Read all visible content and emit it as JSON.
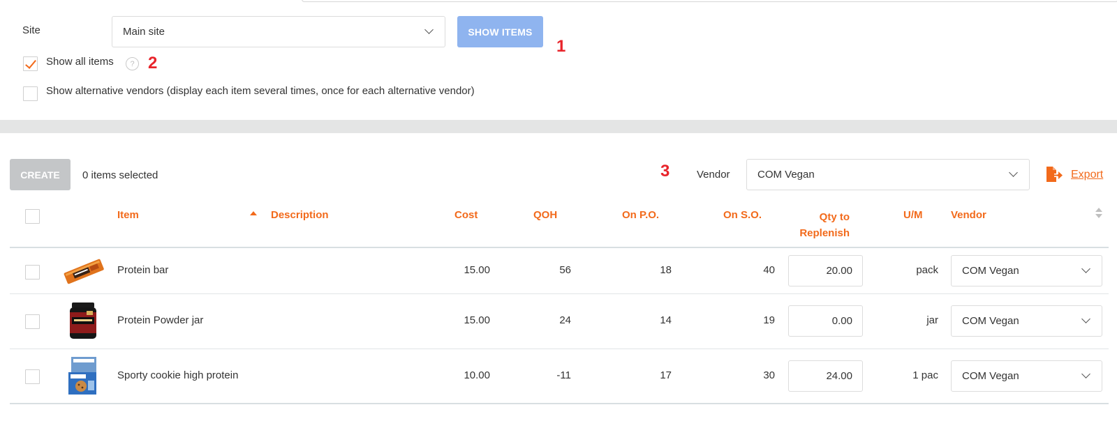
{
  "filters": {
    "site_label": "Site",
    "site_value": "Main site",
    "show_items_button": "SHOW ITEMS",
    "show_all_items_label": "Show all items",
    "show_all_items_checked": true,
    "help_glyph": "?",
    "show_alt_vendors_label": "Show alternative vendors (display each item several times, once for each alternative vendor)",
    "show_alt_vendors_checked": false
  },
  "annotations": {
    "a1": "1",
    "a2": "2",
    "a3": "3"
  },
  "toolbar": {
    "create_button": "CREATE",
    "selected_count": "0 items selected",
    "vendor_label": "Vendor",
    "vendor_value": "COM Vegan",
    "export_label": "Export",
    "export_icon": "export-icon"
  },
  "table": {
    "headers": {
      "item": "Item",
      "description": "Description",
      "cost": "Cost",
      "qoh": "QOH",
      "on_po": "On P.O.",
      "on_so": "On S.O.",
      "qty_line1": "Qty to",
      "qty_line2": "Replenish",
      "um": "U/M",
      "vendor": "Vendor"
    },
    "sorted_column": "item",
    "rows": [
      {
        "name": "Protein bar",
        "image": "protein-bar-image",
        "cost": "15.00",
        "qoh": "56",
        "on_po": "18",
        "on_so": "40",
        "qty": "20.00",
        "um": "pack",
        "vendor": "COM Vegan"
      },
      {
        "name": "Protein Powder jar",
        "image": "protein-powder-jar-image",
        "cost": "15.00",
        "qoh": "24",
        "on_po": "14",
        "on_so": "19",
        "qty": "0.00",
        "um": "jar",
        "vendor": "COM Vegan"
      },
      {
        "name": "Sporty cookie high protein",
        "image": "cookie-box-image",
        "cost": "10.00",
        "qoh": "-11",
        "on_po": "17",
        "on_so": "30",
        "qty": "24.00",
        "um": "1 pac",
        "vendor": "COM Vegan"
      }
    ]
  },
  "colors": {
    "accent": "#f26a1b",
    "primary_button": "#8fb4ef",
    "disabled_button": "#c4c6c8",
    "annotation": "#e8242b"
  }
}
